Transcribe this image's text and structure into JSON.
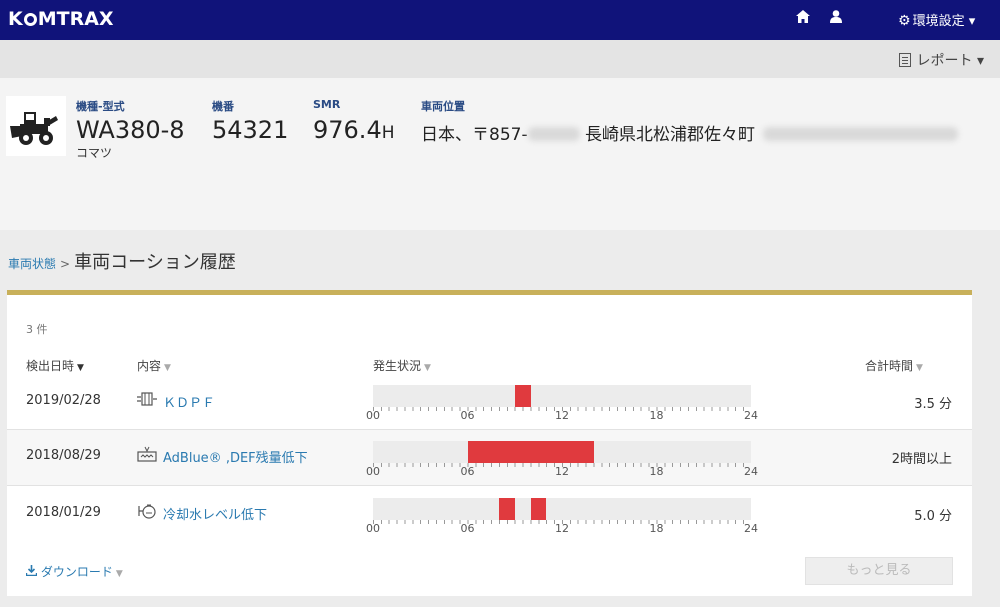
{
  "topbar": {
    "logo_pre": "K",
    "logo_post": "MTRAX",
    "home_icon": "home-icon",
    "user_icon": "user-icon",
    "settings_label": "環境設定",
    "brand_color": "#10137a"
  },
  "reportbar": {
    "report_label": "レポート"
  },
  "machine": {
    "model_label": "機種-型式",
    "model_value": "WA380-8",
    "maker": "コマツ",
    "serial_label": "機番",
    "serial_value": "54321",
    "smr_label": "SMR",
    "smr_value": "976.4",
    "smr_unit": "H",
    "location_label": "車両位置",
    "location_prefix": "日本、〒857-",
    "location_city": "長崎県北松浦郡佐々町"
  },
  "breadcrumb": {
    "parent": "車両状態",
    "separator": ">",
    "current": "車両コーション履歴"
  },
  "history": {
    "count_text": "3 件",
    "columns": {
      "date": "検出日時",
      "content": "内容",
      "status": "発生状況",
      "total": "合計時間"
    },
    "axis_labels": [
      "00",
      "06",
      "12",
      "18",
      "24"
    ],
    "rows": [
      {
        "date": "2019/02/28",
        "content": "ＫＤＰＦ",
        "icon": "dpf-icon",
        "total": "3.5 分",
        "segments": [
          [
            9.0,
            10.0
          ]
        ]
      },
      {
        "date": "2018/08/29",
        "content": "AdBlue® ,DEF残量低下",
        "icon": "def-level-icon",
        "total": "2時間以上",
        "segments": [
          [
            6.0,
            14.0
          ]
        ]
      },
      {
        "date": "2018/01/29",
        "content": "冷却水レベル低下",
        "icon": "coolant-level-icon",
        "total": "5.0 分",
        "segments": [
          [
            8.0,
            9.0
          ],
          [
            10.0,
            11.0
          ]
        ]
      }
    ],
    "download_label": "ダウンロード",
    "more_label": "もっと見る",
    "bar_color": "#e03a3e",
    "accent_color": "#c8b05a"
  }
}
